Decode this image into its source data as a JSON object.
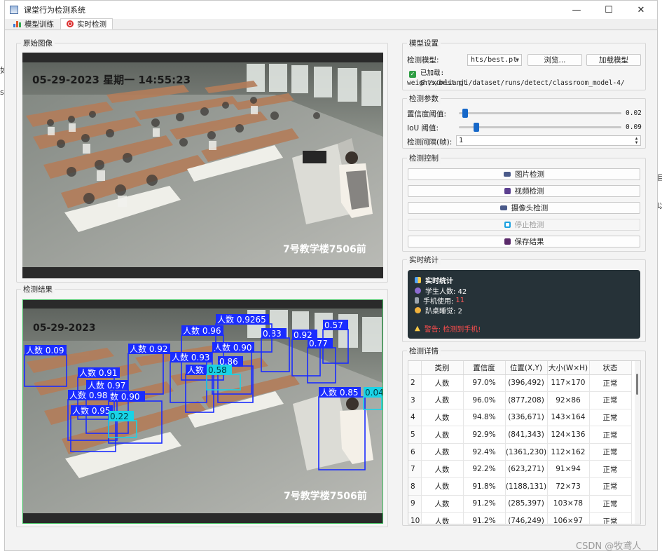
{
  "window": {
    "title": "课堂行为检测系统",
    "buttons": [
      "—",
      "☐",
      "✕"
    ]
  },
  "tabs": [
    {
      "label": "模型训练"
    },
    {
      "label": "实时检测"
    }
  ],
  "original": {
    "title": "原始图像",
    "overlay_date": "05-29-2023  星期一  14:55:23",
    "overlay_building": "7号教学楼7506前"
  },
  "result": {
    "title": "检测结果",
    "overlay_date": "05-29-2023",
    "overlay_building": "7号教学楼7506前",
    "detections": [
      {
        "label": "人数 0.09",
        "color": "blue"
      },
      {
        "label": "人数 0.92",
        "color": "blue"
      },
      {
        "label": "人数 0.91",
        "color": "blue"
      },
      {
        "label": "人数 0.97",
        "color": "blue"
      },
      {
        "label": "人数 0.98",
        "color": "blue"
      },
      {
        "label": "数 0.90",
        "color": "blue"
      },
      {
        "label": "人数 0.95",
        "color": "blue"
      },
      {
        "label": "人数 0.96",
        "color": "blue"
      },
      {
        "label": "人数 0.90",
        "color": "blue"
      },
      {
        "label": "人数 0.93",
        "color": "blue"
      },
      {
        "label": "0.86",
        "color": "blue"
      },
      {
        "label": "人数 0.91",
        "color": "blue"
      },
      {
        "label": "0.83",
        "color": "blue"
      },
      {
        "label": "人数 0.9265",
        "color": "blue"
      },
      {
        "label": "0.92",
        "color": "blue"
      },
      {
        "label": "0.77",
        "color": "blue"
      },
      {
        "label": "0.57",
        "color": "blue"
      },
      {
        "label": "人数 0.85",
        "color": "blue"
      },
      {
        "label": "0.04",
        "color": "cyan"
      },
      {
        "label": "0.58",
        "color": "cyan"
      },
      {
        "label": "0.22",
        "color": "cyan"
      }
    ]
  },
  "model_settings": {
    "title": "模型设置",
    "model_label": "检测模型:",
    "model_value": "hts/best.pt",
    "browse": "浏览...",
    "load": "加载模型",
    "loaded_prefix": "已加载:",
    "loaded_path_1": "G:/xunlianji/dataset/runs/detect/classroom_model-4/",
    "loaded_path_2": "weights/best.pt"
  },
  "params": {
    "title": "检测参数",
    "conf_label": "置信度阈值:",
    "conf_value": "0.02",
    "conf_fraction": 0.02,
    "iou_label": "IoU 阈值:",
    "iou_value": "0.09",
    "iou_fraction": 0.09,
    "interval_label": "检测间隔(帧):",
    "interval_value": "1"
  },
  "control": {
    "title": "检测控制",
    "image_btn": "图片检测",
    "video_btn": "视频检测",
    "camera_btn": "摄像头检测",
    "stop_btn": "停止检测",
    "save_btn": "保存结果"
  },
  "stats": {
    "title": "实时统计",
    "header": "实时统计",
    "students": "学生人数: 42",
    "phone_label": "手机使用:",
    "phone_count": "11",
    "sleep": "趴桌睡觉: 2",
    "warning": "警告: 检测到手机!"
  },
  "details": {
    "title": "检测详情",
    "columns": [
      "",
      "类别",
      "置信度",
      "位置(X,Y)",
      "大小(W×H)",
      "状态"
    ],
    "rows": [
      [
        "2",
        "人数",
        "97.0%",
        "(396,492)",
        "117×170",
        "正常"
      ],
      [
        "3",
        "人数",
        "96.0%",
        "(877,208)",
        "92×86",
        "正常"
      ],
      [
        "4",
        "人数",
        "94.8%",
        "(336,671)",
        "143×164",
        "正常"
      ],
      [
        "5",
        "人数",
        "92.9%",
        "(841,343)",
        "124×136",
        "正常"
      ],
      [
        "6",
        "人数",
        "92.4%",
        "(1361,230)",
        "112×162",
        "正常"
      ],
      [
        "7",
        "人数",
        "92.2%",
        "(623,271)",
        "91×94",
        "正常"
      ],
      [
        "8",
        "人数",
        "91.8%",
        "(1188,131)",
        "72×73",
        "正常"
      ],
      [
        "9",
        "人数",
        "91.2%",
        "(285,397)",
        "103×78",
        "正常"
      ],
      [
        "10",
        "人数",
        "91.2%",
        "(746,249)",
        "106×97",
        "正常"
      ]
    ]
  },
  "watermark": "CSDN @牧鸢人",
  "colors": {
    "accent": "#1668c9",
    "box_blue": "#1a2cff",
    "box_cyan": "#19d3e6",
    "stats_bg": "#263238",
    "phone_red": "#ff5a5a",
    "warn_red": "#ff4d4d"
  }
}
